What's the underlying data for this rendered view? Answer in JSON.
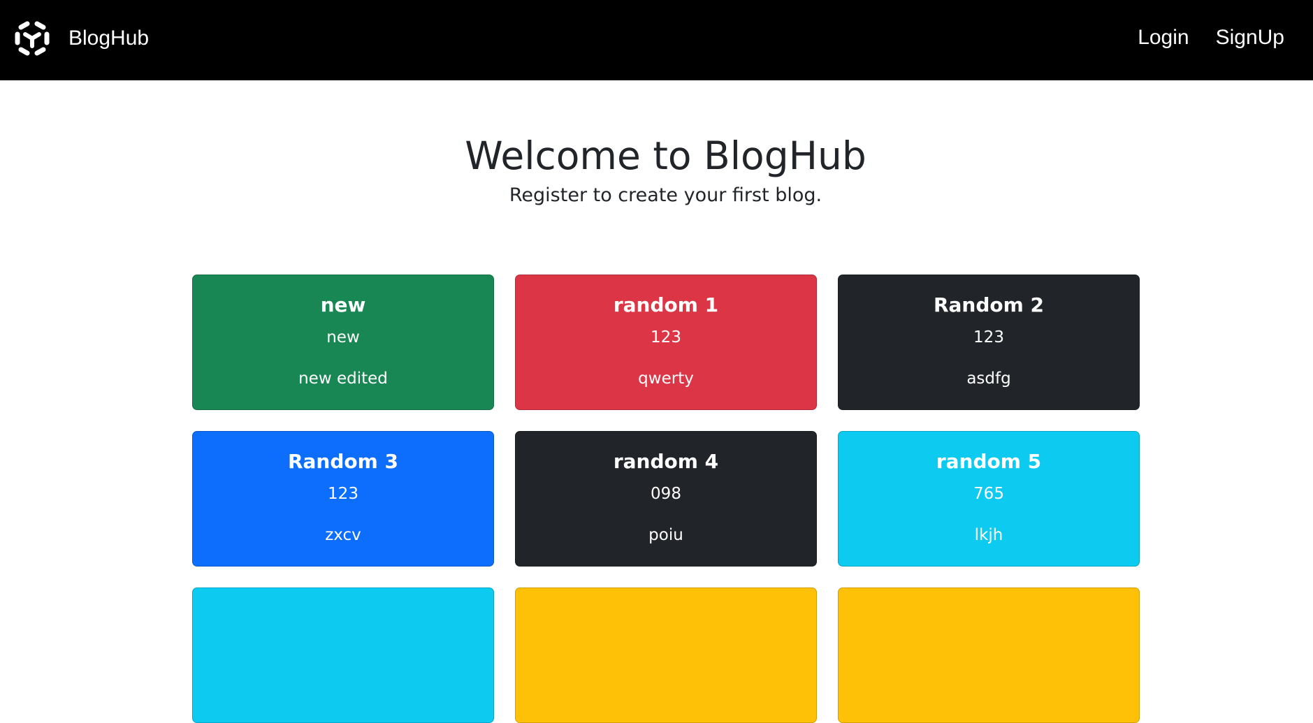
{
  "navbar": {
    "brand": "BlogHub",
    "brand_icon": "hexagon-logo-icon",
    "links": [
      {
        "label": "Login"
      },
      {
        "label": "SignUp"
      }
    ]
  },
  "hero": {
    "title": "Welcome to BlogHub",
    "subtitle": "Register to create your first blog."
  },
  "cards": [
    {
      "title": "new",
      "subtitle": "new",
      "body": "new edited",
      "color": "#198754"
    },
    {
      "title": "random 1",
      "subtitle": "123",
      "body": "qwerty",
      "color": "#dc3545"
    },
    {
      "title": "Random 2",
      "subtitle": "123",
      "body": "asdfg",
      "color": "#212529"
    },
    {
      "title": "Random 3",
      "subtitle": "123",
      "body": "zxcv",
      "color": "#0d6efd"
    },
    {
      "title": "random 4",
      "subtitle": "098",
      "body": "poiu",
      "color": "#212529"
    },
    {
      "title": "random 5",
      "subtitle": "765",
      "body": "lkjh",
      "color": "#0dcaf0"
    },
    {
      "title": "",
      "subtitle": "",
      "body": "",
      "color": "#0dcaf0"
    },
    {
      "title": "",
      "subtitle": "",
      "body": "",
      "color": "#ffc107"
    },
    {
      "title": "",
      "subtitle": "",
      "body": "",
      "color": "#ffc107"
    }
  ]
}
